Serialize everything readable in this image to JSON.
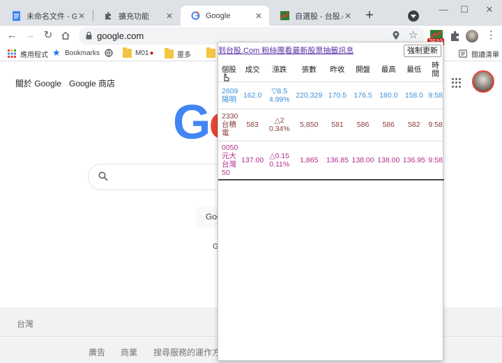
{
  "tabs": [
    {
      "title": "未命名文件 - Google",
      "icon": "docs-icon",
      "active": false
    },
    {
      "title": "擴充功能",
      "icon": "puzzle-icon",
      "active": false
    },
    {
      "title": "Google",
      "icon": "google-g-icon",
      "active": true
    },
    {
      "title": "自選股 - 台股.com",
      "icon": "stock-icon",
      "active": false
    }
  ],
  "toolbar": {
    "url": "google.com",
    "badge": "7532"
  },
  "bookmarks": [
    {
      "label": "應用程式",
      "icon": "apps-grid-icon"
    },
    {
      "label": "Bookmarks",
      "icon": "star-icon"
    },
    {
      "label": "",
      "icon": "globe-icon"
    },
    {
      "label": "M01",
      "icon": "folder-icon"
    },
    {
      "label": "靈多",
      "icon": "folder-icon"
    },
    {
      "label": "閱讀清單",
      "icon": "reading-list-icon"
    }
  ],
  "google": {
    "about": "關於 Google",
    "store": "Google 商店",
    "logo_visible": "Go",
    "button_text": "Goo",
    "text": "G",
    "country": "台灣",
    "footer_links": [
      "廣告",
      "商業",
      "搜尋服務的運作方式"
    ]
  },
  "popup": {
    "link": "到台股.Com 粉絲團看最新股票抽籤訊息",
    "refresh": "強制更新",
    "headers": [
      "個股",
      "成交",
      "漲跌",
      "張數",
      "昨收",
      "開盤",
      "最高",
      "最低",
      "時間"
    ],
    "rows": [
      {
        "code": "2609",
        "name": "陽明",
        "price": "162.0",
        "chg_sym": "▽8.5",
        "chg_pct": "4.99%",
        "volume": "220,329",
        "prev": "170.5",
        "open": "176.5",
        "high": "180.0",
        "low": "158.0",
        "time": "9:58"
      },
      {
        "code": "2330",
        "name": "台積電",
        "price": "583",
        "chg_sym": "△2",
        "chg_pct": "0.34%",
        "volume": "5,850",
        "prev": "581",
        "open": "586",
        "high": "586",
        "low": "582",
        "time": "9:58"
      },
      {
        "code": "0050",
        "name": "元大台灣50",
        "price": "137.00",
        "chg_sym": "△0.15",
        "chg_pct": "0.11%",
        "volume": "1,865",
        "prev": "136.85",
        "open": "138.00",
        "high": "138.00",
        "low": "136.95",
        "time": "9:58"
      }
    ]
  }
}
